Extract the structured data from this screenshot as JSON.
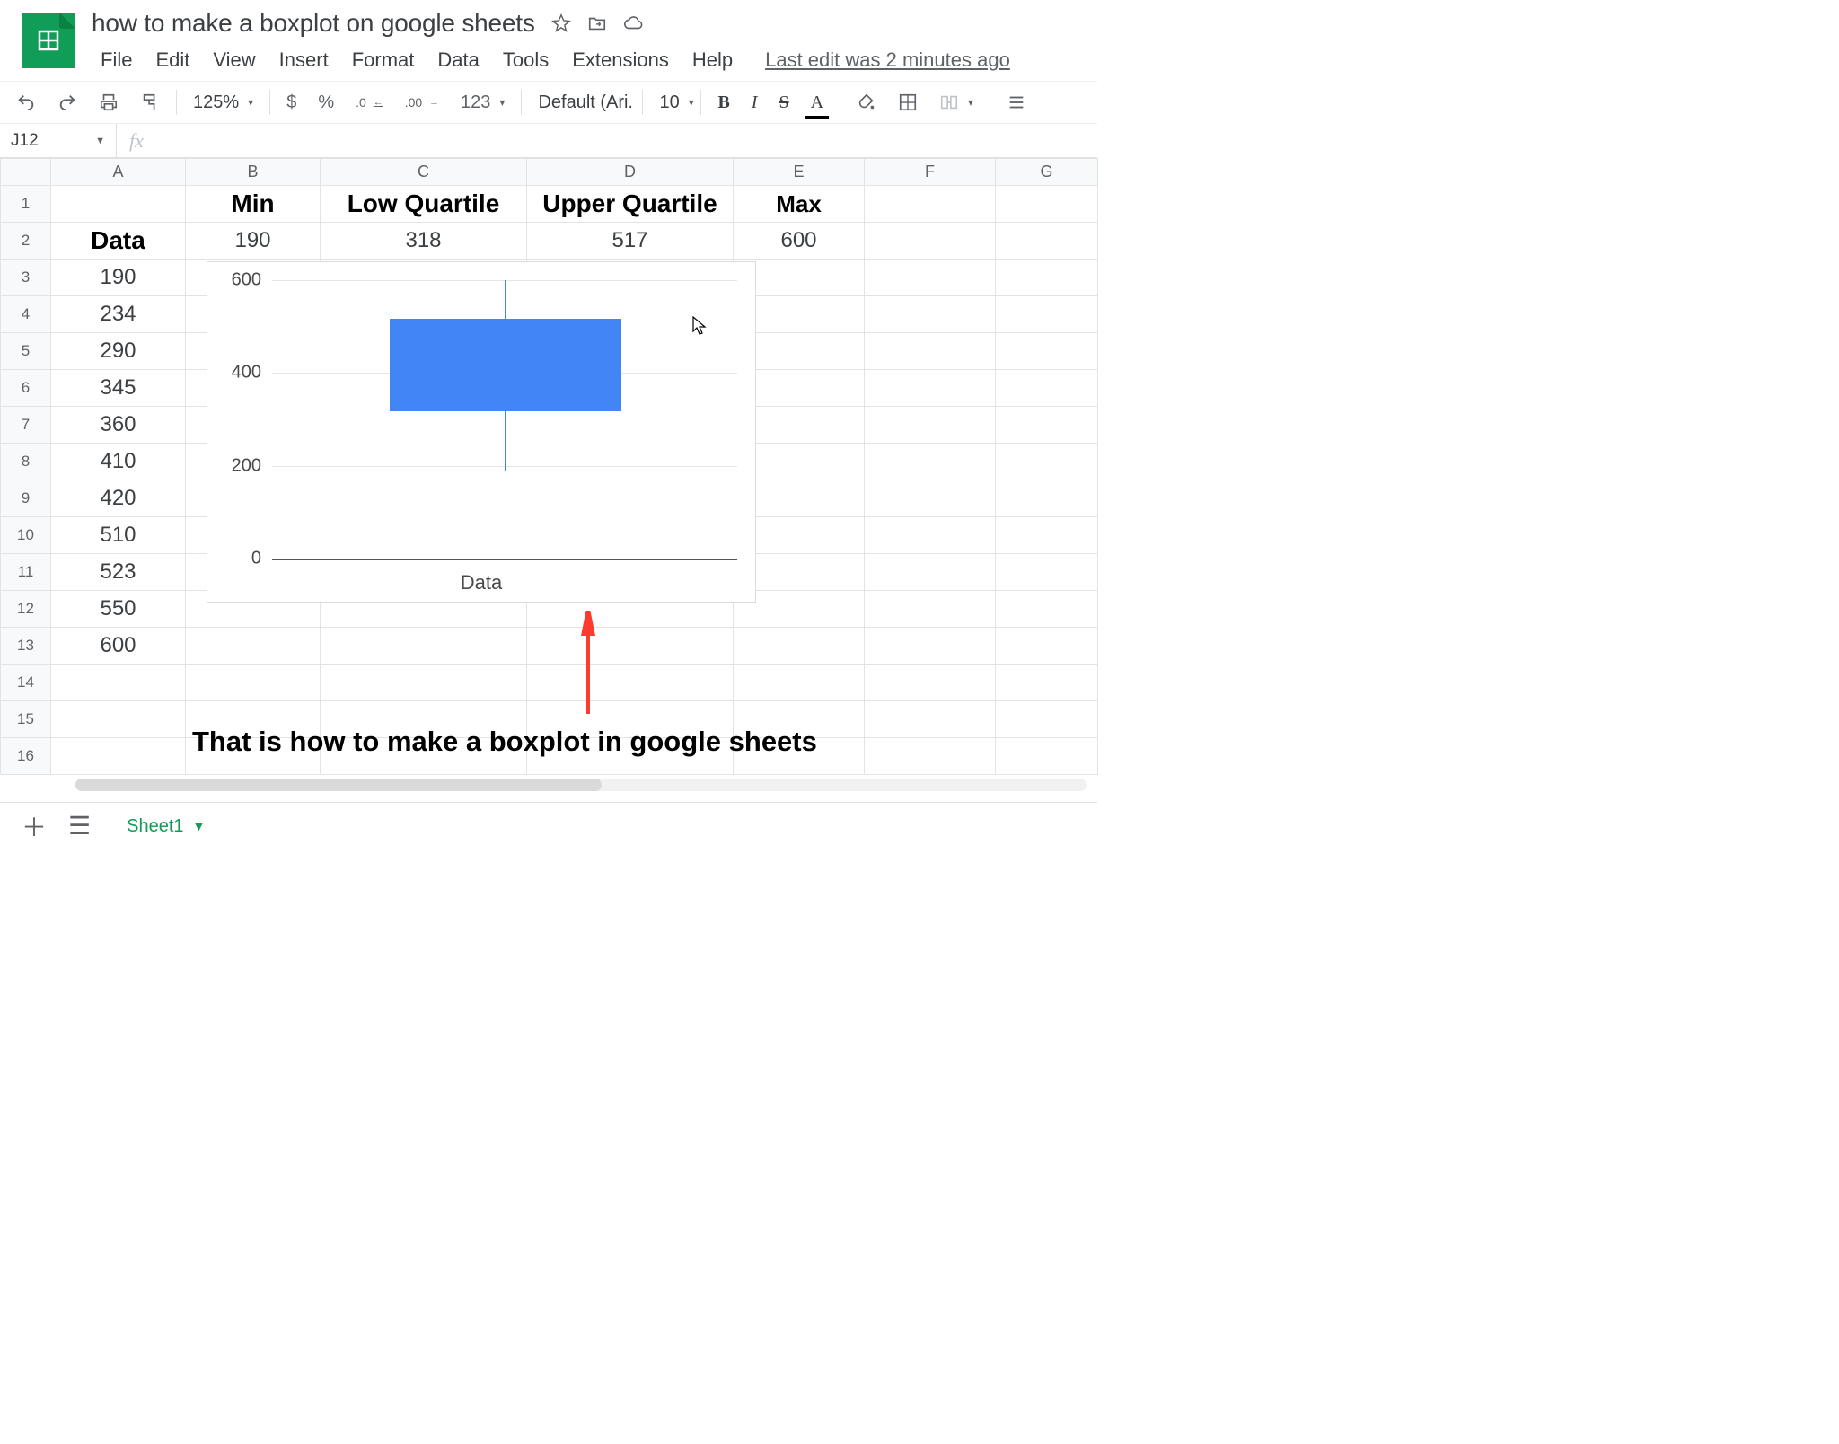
{
  "doc": {
    "title": "how to make a boxplot on google sheets",
    "last_edit": "Last edit was 2 minutes ago"
  },
  "menu": {
    "file": "File",
    "edit": "Edit",
    "view": "View",
    "insert": "Insert",
    "format": "Format",
    "data": "Data",
    "tools": "Tools",
    "extensions": "Extensions",
    "help": "Help"
  },
  "toolbar": {
    "zoom": "125%",
    "currency": "$",
    "percent": "%",
    "dec_dec": ".0",
    "inc_dec": ".00",
    "numfmt": "123",
    "font": "Default (Ari...",
    "fontsize": "10",
    "bold": "B",
    "italic": "I",
    "strike": "S",
    "textcolor": "A"
  },
  "namebox": {
    "ref": "J12",
    "fx": "fx"
  },
  "columns": [
    "A",
    "B",
    "C",
    "D",
    "E",
    "F",
    "G"
  ],
  "headers": {
    "B": "Min",
    "C": "Low Quartile",
    "D": "Upper Quartile",
    "E": "Max",
    "A2": "Data"
  },
  "stats": {
    "min": "190",
    "lowq": "318",
    "upq": "517",
    "max": "600"
  },
  "data_values": [
    "190",
    "234",
    "290",
    "345",
    "360",
    "410",
    "420",
    "510",
    "523",
    "550",
    "600"
  ],
  "row_labels": [
    "1",
    "2",
    "3",
    "4",
    "5",
    "6",
    "7",
    "8",
    "9",
    "10",
    "11",
    "12",
    "13",
    "14",
    "15",
    "16"
  ],
  "chart_data": {
    "type": "boxplot",
    "categories": [
      "Data"
    ],
    "series": [
      {
        "name": "Data",
        "min": 190,
        "q1": 318,
        "q3": 517,
        "max": 600
      }
    ],
    "yticks": [
      0,
      200,
      400,
      600
    ],
    "ylim": [
      0,
      600
    ],
    "xlabel": "Data",
    "ylabel": "",
    "title": ""
  },
  "annotation": "That is how to make a boxplot in google sheets",
  "footer": {
    "sheet_tab": "Sheet1"
  }
}
